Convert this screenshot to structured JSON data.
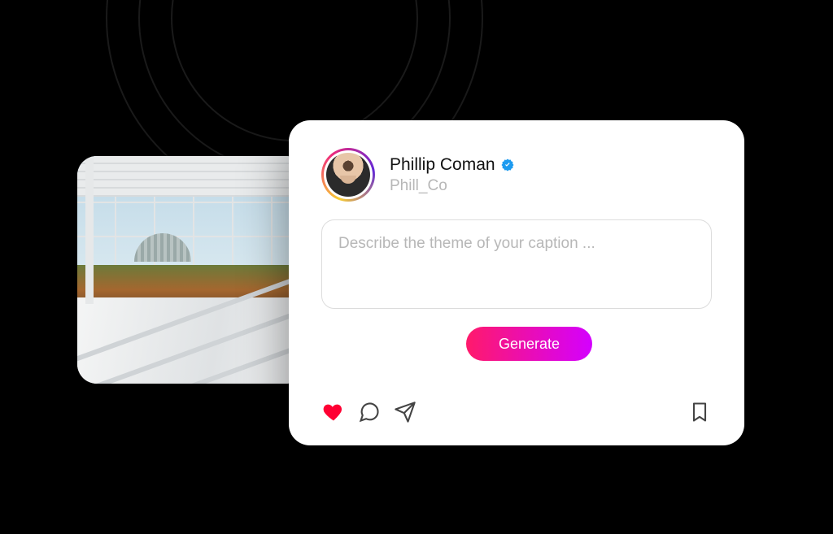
{
  "profile": {
    "display_name": "Phillip Coman",
    "handle": "Phill_Co",
    "verified": true
  },
  "caption_input": {
    "value": "",
    "placeholder": "Describe the theme of your caption ..."
  },
  "buttons": {
    "generate": "Generate"
  },
  "icons": {
    "like": "heart-icon",
    "comment": "comment-icon",
    "share": "share-icon",
    "bookmark": "bookmark-icon",
    "verified": "verified-badge-icon"
  },
  "colors": {
    "like_fill": "#ff0033",
    "icon_stroke": "#444444",
    "verified_fill": "#1d9bf0",
    "generate_grad_start": "#ff1a6b",
    "generate_grad_end": "#d400ff"
  }
}
